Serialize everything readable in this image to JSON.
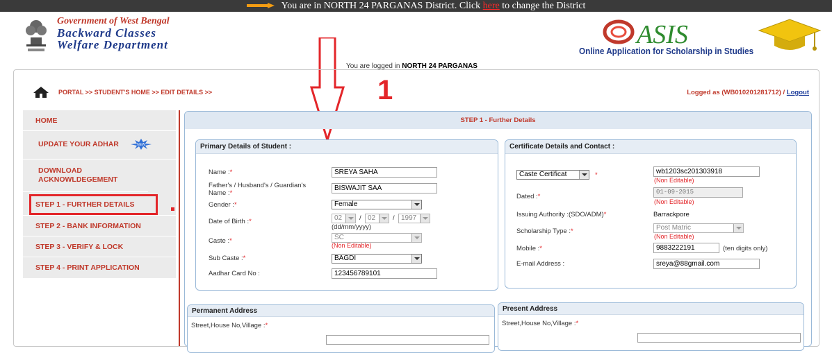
{
  "banner": {
    "prefix": "You are in NORTH 24 PARGANAS District. Click ",
    "link": "here",
    "suffix": " to change the District"
  },
  "header": {
    "gov_line1": "Government of West Bengal",
    "gov_line2": "Backward Classes",
    "gov_line3": "Welfare Department",
    "logo_text": "ASIS",
    "logo_subtitle": "Online Application for Scholarship in Studies",
    "logged_prefix": "You are logged in",
    "logged_district": "NORTH 24 PARGANAS"
  },
  "breadcrumb": "PORTAL >> STUDENT'S HOME >> EDIT DETAILS >>",
  "annotation_number": "1",
  "user": {
    "logged_as": "Logged as (WB010201281712) /",
    "logout": "Logout"
  },
  "sidebar": {
    "items": [
      {
        "label": "HOME"
      },
      {
        "label": "UPDATE YOUR ADHAR"
      },
      {
        "label": "DOWNLOAD ACKNOWLDEGEMENT"
      },
      {
        "label": "STEP 1 - FURTHER DETAILS"
      },
      {
        "label": "STEP 2 - BANK INFORMATION"
      },
      {
        "label": "STEP 3 - VERIFY & LOCK"
      },
      {
        "label": "STEP 4 - PRINT APPLICATION"
      }
    ],
    "new_badge": "NEW"
  },
  "step": {
    "title": "STEP 1 - Further Details"
  },
  "primary": {
    "title": "Primary Details of Student :",
    "name_label": "Name :",
    "name_value": "SREYA SAHA",
    "father_label_1": "Father's / Husband's / Guardian's",
    "father_label_2": "Name :",
    "father_value": "BISWAJIT SAA",
    "gender_label": "Gender :",
    "gender_value": "Female",
    "dob_label": "Date of Birth :",
    "dob_day": "02",
    "dob_month": "02",
    "dob_year": "1997",
    "dob_sep": "/",
    "dob_format": "(dd/mm/yyyy)",
    "caste_label": "Caste :",
    "caste_value": "SC",
    "caste_note": "(Non Editable)",
    "subcaste_label": "Sub Caste :",
    "subcaste_value": "BAGDI",
    "aadhar_label": "Aadhar Card No :",
    "aadhar_value": "123456789101"
  },
  "certificate": {
    "title": "Certificate Details and Contact :",
    "cert_type": "Caste Certificat",
    "cert_no": "wb1203sc201303918",
    "cert_no_note": "(Non Editable)",
    "dated_label": "Dated :",
    "dated_value": "01-09-2015",
    "dated_note": "(Non Editable)",
    "authority_label": "Issuing Authority :(SDO/ADM)",
    "authority_value": "Barrackpore",
    "scholarship_label": "Scholarship Type :",
    "scholarship_value": "Post Matric",
    "scholarship_note": "(Non Editable)",
    "mobile_label": "Mobile :",
    "mobile_value": "9883222191",
    "mobile_note": "(ten digits only)",
    "email_label": "E-mail Address :",
    "email_value": "sreya@88gmail.com"
  },
  "permanent": {
    "title": "Permanent Address",
    "street_label": "Street,House No,Village :"
  },
  "present": {
    "title": "Present Address",
    "street_label": "Street,House No,Village :"
  },
  "colors": {
    "accent_red": "#c0392b",
    "highlight_red": "#e3262a",
    "navy": "#1f3a8a"
  }
}
